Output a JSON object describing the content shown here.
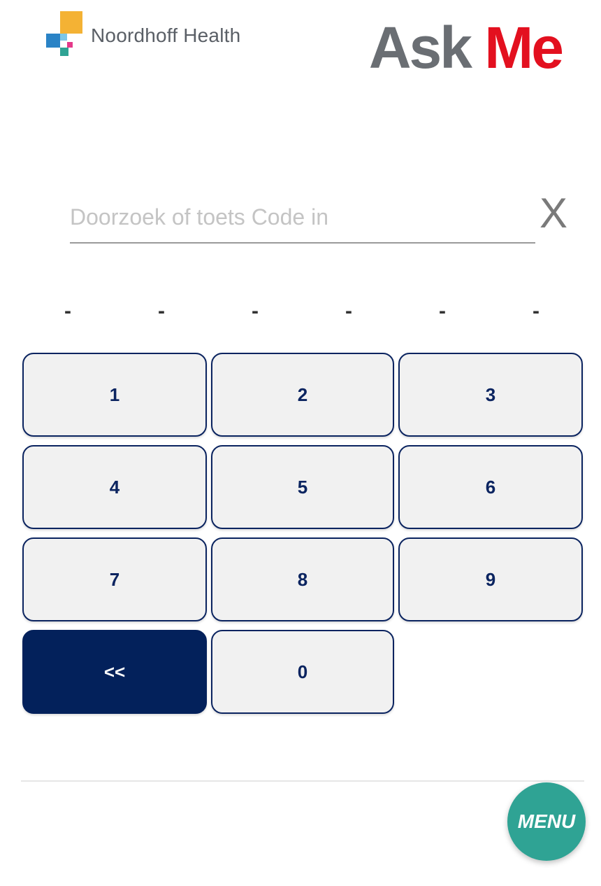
{
  "header": {
    "brand_name": "Noordhoff Health",
    "app_title_part1": "Ask",
    "app_title_part2": "Me"
  },
  "search": {
    "placeholder": "Doorzoek of toets Code in",
    "value": "",
    "clear_label": "X"
  },
  "code_slots": [
    "-",
    "-",
    "-",
    "-",
    "-",
    "-"
  ],
  "keypad": {
    "keys": [
      "1",
      "2",
      "3",
      "4",
      "5",
      "6",
      "7",
      "8",
      "9"
    ],
    "backspace_label": "<<",
    "zero_label": "0"
  },
  "footer": {
    "menu_label": "MENU"
  },
  "colors": {
    "navy": "#0b2460",
    "brand_red": "#e3101f",
    "menu_teal": "#2fa394",
    "key_bg": "#f1f1f1"
  }
}
